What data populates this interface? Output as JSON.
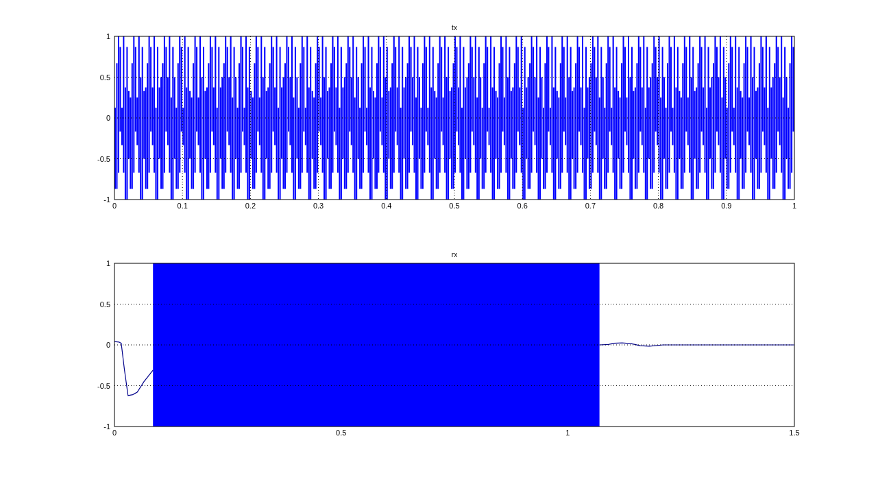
{
  "plots": [
    {
      "title": "tx",
      "kind": "dense",
      "xticks": [
        "0",
        "0.1",
        "0.2",
        "0.3",
        "0.4",
        "0.5",
        "0.6",
        "0.7",
        "0.8",
        "0.9",
        "1"
      ],
      "yticks": [
        "1",
        "0.5",
        "0",
        "-0.5",
        "-1"
      ]
    },
    {
      "title": "rx",
      "kind": "burst",
      "xticks": [
        "0",
        "0.5",
        "1",
        "1.5"
      ],
      "yticks": [
        "1",
        "0.5",
        "0",
        "-0.5",
        "-1"
      ]
    }
  ]
}
